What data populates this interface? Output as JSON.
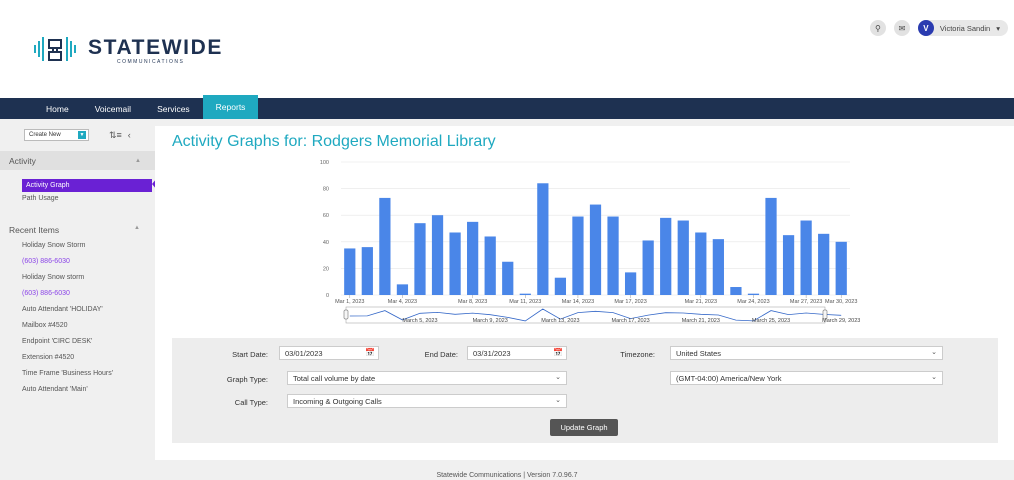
{
  "brand": {
    "name": "STATEWIDE",
    "tagline": "COMMUNICATIONS"
  },
  "top_right": {
    "search_icon": "search-icon",
    "notify_icon": "notifications-icon",
    "avatar_initial": "V",
    "user_name": "Victoria Sandin",
    "caret": "▾"
  },
  "nav": {
    "items": [
      "Home",
      "Voicemail",
      "Services",
      "Reports"
    ],
    "active": "Reports"
  },
  "sidebar": {
    "create_new": "Create New",
    "activity_header": "Activity",
    "activity_items": [
      "Activity Graph",
      "Path Usage"
    ],
    "recent_header": "Recent Items",
    "recent_items": [
      {
        "label": "Holiday Snow Storm",
        "link": false
      },
      {
        "label": "(603) 886-6030",
        "link": true
      },
      {
        "label": "Holiday Snow storm",
        "link": false
      },
      {
        "label": "(603) 886-6030",
        "link": true
      },
      {
        "label": "Auto Attendant 'HOLIDAY'",
        "link": false
      },
      {
        "label": "Mailbox #4520",
        "link": false
      },
      {
        "label": "Endpoint 'CIRC DESK'",
        "link": false
      },
      {
        "label": "Extension #4520",
        "link": false
      },
      {
        "label": "Time Frame 'Business Hours'",
        "link": false
      },
      {
        "label": "Auto Attendant 'Main'",
        "link": false
      }
    ]
  },
  "page_title": "Activity Graphs for: Rodgers Memorial Library",
  "chart_data": {
    "type": "bar",
    "ylim": [
      0,
      100
    ],
    "yticks": [
      0,
      20,
      40,
      60,
      80,
      100
    ],
    "values": [
      35,
      36,
      73,
      8,
      54,
      60,
      47,
      55,
      44,
      25,
      1,
      84,
      13,
      59,
      68,
      59,
      17,
      41,
      58,
      56,
      47,
      42,
      6,
      1,
      73,
      45,
      56,
      46,
      40
    ],
    "x_labels": [
      "Mar 1, 2023",
      "Mar 4, 2023",
      "Mar 8, 2023",
      "Mar 11, 2023",
      "Mar 14, 2023",
      "Mar 17, 2023",
      "Mar 21, 2023",
      "Mar 24, 2023",
      "Mar 27, 2023",
      "Mar 30, 2023"
    ],
    "navigator_labels": [
      "March 5, 2023",
      "March 9, 2023",
      "March 13, 2023",
      "March 17, 2023",
      "March 21, 2023",
      "March 25, 2023",
      "March 29, 2023"
    ],
    "bar_color": "#4a86e8"
  },
  "form": {
    "start_date_label": "Start Date:",
    "start_date": "03/01/2023",
    "end_date_label": "End Date:",
    "end_date": "03/31/2023",
    "timezone_label": "Timezone:",
    "timezone_country": "United States",
    "timezone_zone": "(GMT-04:00) America/New York",
    "graph_type_label": "Graph Type:",
    "graph_type": "Total call volume by date",
    "call_type_label": "Call Type:",
    "call_type": "Incoming & Outgoing Calls",
    "update_button": "Update Graph"
  },
  "footer": "Statewide Communications | Version 7.0.96.7"
}
